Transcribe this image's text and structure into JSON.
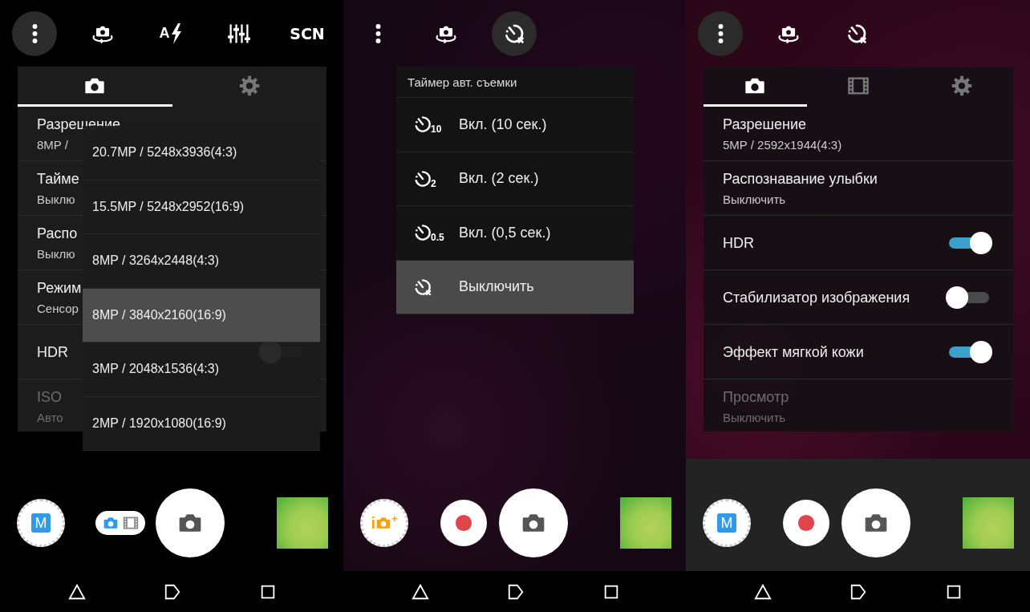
{
  "screens": [
    {
      "controls_shaded": false,
      "top_bar": [
        {
          "kind": "menu",
          "highlighted": true
        },
        {
          "kind": "switch_camera",
          "highlighted": false
        },
        {
          "kind": "flash",
          "label": "A",
          "highlighted": false
        },
        {
          "kind": "adjust",
          "highlighted": false
        },
        {
          "kind": "scene",
          "label": "SCN",
          "highlighted": false
        }
      ],
      "settings": {
        "tabs": [
          {
            "kind": "photo",
            "selected": true
          },
          {
            "kind": "general",
            "selected": false
          }
        ],
        "rows": [
          {
            "kind": "value",
            "title": "Разрешение",
            "value": "8MP /",
            "disabled": false
          },
          {
            "kind": "value",
            "title": "Тайме",
            "value": "Выклю",
            "disabled": false
          },
          {
            "kind": "value",
            "title": "Распо",
            "value": "Выклю",
            "disabled": false
          },
          {
            "kind": "value",
            "title": "Режим",
            "value": "Сенсор",
            "disabled": false
          },
          {
            "kind": "toggle",
            "title": "HDR",
            "on": false,
            "disabled": false
          },
          {
            "kind": "value",
            "title": "ISO",
            "value": "Авто",
            "disabled": true
          }
        ]
      },
      "resolution_menu": {
        "options": [
          {
            "label": "20.7MP / 5248x3936(4:3)",
            "selected": false
          },
          {
            "label": "15.5MP / 5248x2952(16:9)",
            "selected": false
          },
          {
            "label": "8MP / 3264x2448(4:3)",
            "selected": false
          },
          {
            "label": "8MP / 3840x2160(16:9)",
            "selected": true
          },
          {
            "label": "3MP / 2048x1536(4:3)",
            "selected": false
          },
          {
            "label": "2MP / 1920x1080(16:9)",
            "selected": false
          }
        ]
      },
      "controls": {
        "mode_button": {
          "kind": "manual",
          "label": "M"
        },
        "capture_switch": {
          "kind": "photo_video",
          "options": [
            {
              "kind": "photo",
              "selected": true
            },
            {
              "kind": "video",
              "selected": false
            }
          ]
        }
      }
    },
    {
      "controls_shaded": false,
      "top_bar": [
        {
          "kind": "menu",
          "highlighted": false
        },
        {
          "kind": "switch_camera",
          "highlighted": false
        },
        {
          "kind": "timer",
          "highlighted": true
        }
      ],
      "timer_menu": {
        "title": "Таймер авт. съемки",
        "options": [
          {
            "kind": "timer",
            "duration": "10",
            "label": "Вкл. (10 сек.)",
            "selected": false
          },
          {
            "kind": "timer",
            "duration": "2",
            "label": "Вкл. (2 сек.)",
            "selected": false
          },
          {
            "kind": "timer",
            "duration": "0.5",
            "label": "Вкл. (0,5 сек.)",
            "selected": false
          },
          {
            "kind": "off",
            "label": "Выключить",
            "selected": true
          }
        ]
      },
      "controls": {
        "mode_button": {
          "kind": "auto",
          "label": "i",
          "badge": "+"
        },
        "capture_switch": {
          "kind": "record"
        }
      }
    },
    {
      "controls_shaded": true,
      "top_bar": [
        {
          "kind": "menu",
          "highlighted": true
        },
        {
          "kind": "switch_camera",
          "highlighted": false
        },
        {
          "kind": "timer",
          "highlighted": false
        }
      ],
      "settings": {
        "tabs": [
          {
            "kind": "photo",
            "selected": true
          },
          {
            "kind": "video",
            "selected": false
          },
          {
            "kind": "general",
            "selected": false
          }
        ],
        "rows": [
          {
            "kind": "value",
            "title": "Разрешение",
            "value": "5MP / 2592x1944(4:3)",
            "disabled": false
          },
          {
            "kind": "value",
            "title": "Распознавание улыбки",
            "value": "Выключить",
            "disabled": false
          },
          {
            "kind": "toggle",
            "title": "HDR",
            "on": true,
            "disabled": false
          },
          {
            "kind": "toggle",
            "title": "Стабилизатор изображения",
            "on": false,
            "disabled": false
          },
          {
            "kind": "toggle",
            "title": "Эффект мягкой кожи",
            "on": true,
            "disabled": false
          },
          {
            "kind": "value",
            "title": "Просмотр",
            "value": "Выключить",
            "disabled": true
          }
        ]
      },
      "controls": {
        "mode_button": {
          "kind": "manual",
          "label": "M"
        },
        "capture_switch": {
          "kind": "record"
        }
      }
    }
  ]
}
